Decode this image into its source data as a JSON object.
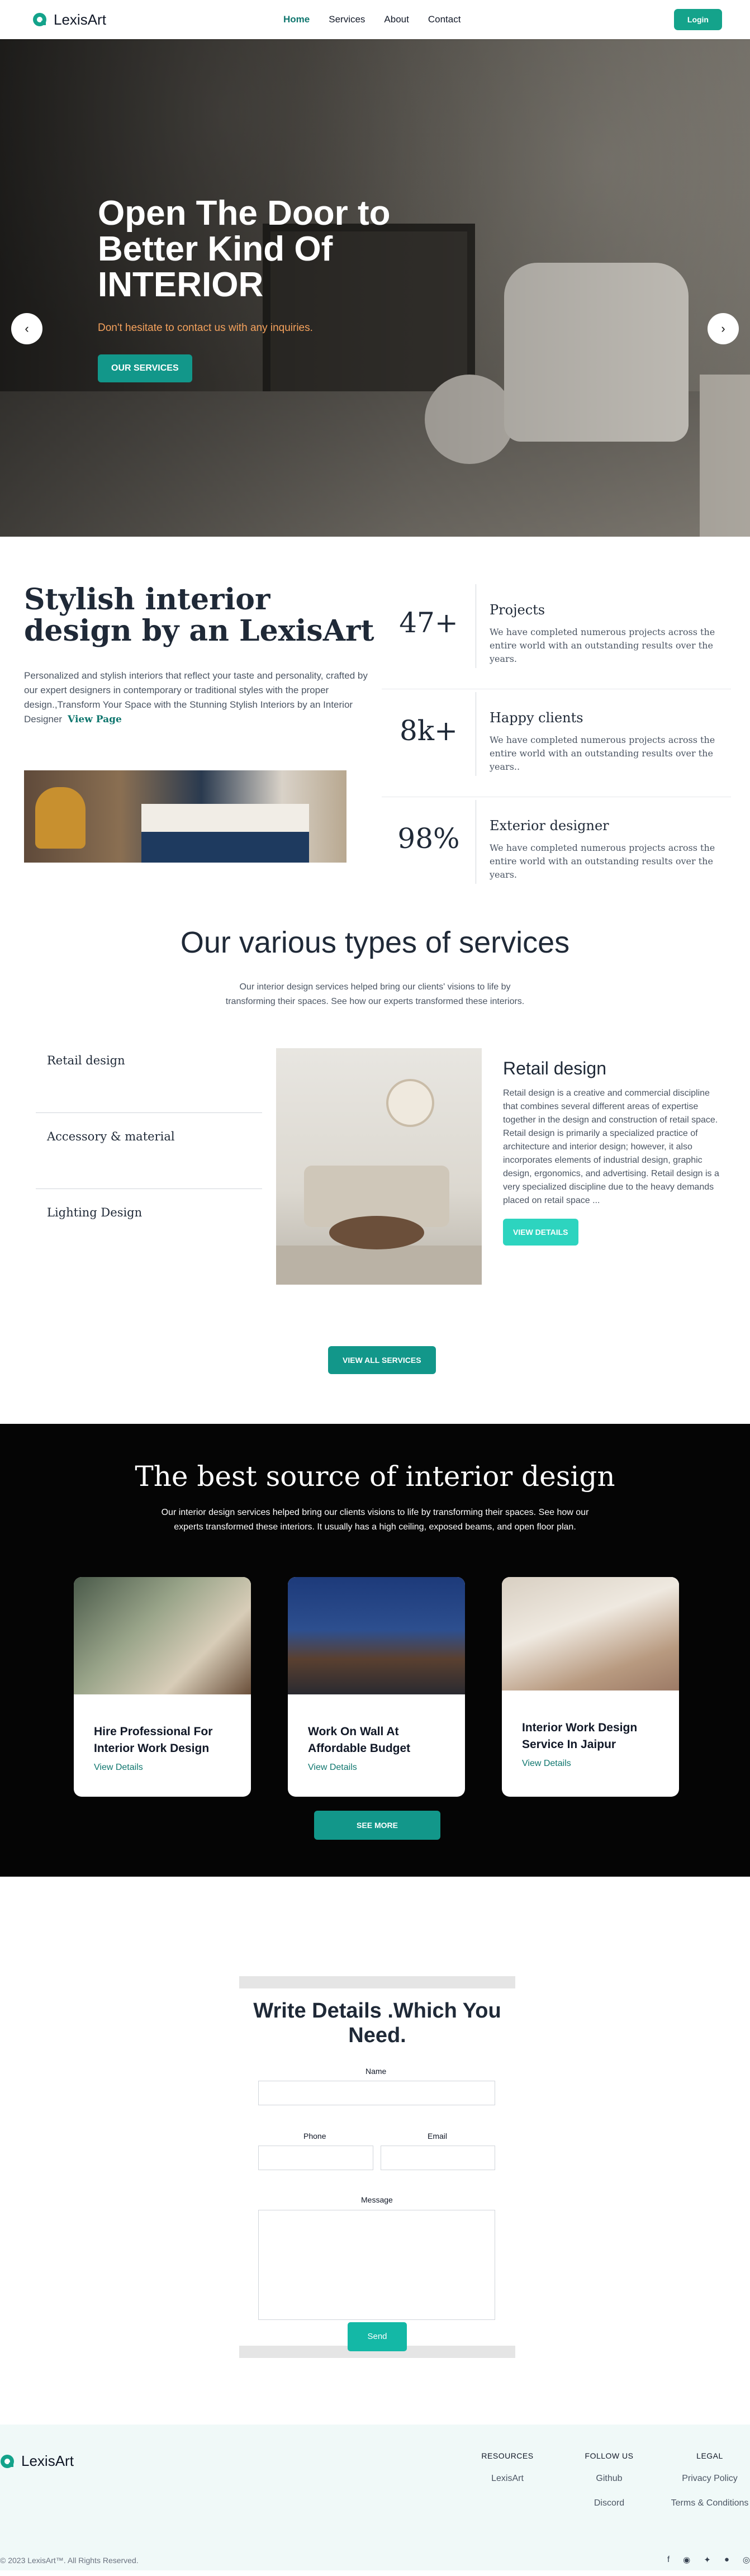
{
  "brand": {
    "name": "LexisArt",
    "accent": "#12978a"
  },
  "nav": {
    "items": [
      "Home",
      "Services",
      "About",
      "Contact"
    ],
    "login": "Login"
  },
  "hero": {
    "title_line1": "Open The Door to",
    "title_line2": "Better Kind Of",
    "title_line3": "INTERIOR",
    "subtitle": "Don't hesitate to contact us with any inquiries.",
    "button": "OUR SERVICES",
    "prev_icon": "‹",
    "next_icon": "›"
  },
  "intro": {
    "title": "Stylish interior design by an LexisArt",
    "description": "Personalized and stylish interiors that reflect your taste and personality, crafted by our expert designers in contemporary or traditional styles with the proper design.,Transform Your Space with the Stunning Stylish Interiors by an Interior Designer",
    "link": "View Page",
    "stats": [
      {
        "value": "47+",
        "title": "Projects",
        "text": "We have completed numerous projects across the entire world with an outstanding results over the years."
      },
      {
        "value": "8k+",
        "title": "Happy clients",
        "text": "We have completed numerous projects across the entire world with an outstanding results over the years.."
      },
      {
        "value": "98%",
        "title": "Exterior designer",
        "text": "We have completed numerous projects across the entire world with an outstanding results over the years."
      }
    ]
  },
  "services": {
    "title": "Our various types of services",
    "subtitle": "Our interior design services helped bring our clients' visions to life by transforming their spaces. See how our experts transformed these interiors.",
    "list": [
      "Retail design",
      "Accessory & material",
      "Lighting Design"
    ],
    "detail_title": "Retail design",
    "detail_text": "Retail design is a creative and commercial discipline that combines several different areas of expertise together in the design and construction of retail space. Retail design is primarily a specialized practice of architecture and interior design; however, it also incorporates elements of industrial design, graphic design, ergonomics, and advertising. Retail design is a very specialized discipline due to the heavy demands placed on retail space ...",
    "detail_button": "VIEW DETAILS",
    "view_all": "VIEW ALL SERVICES"
  },
  "best": {
    "title": "The best source of interior design",
    "subtitle": "Our interior design services helped bring our clients visions to life by transforming their spaces. See how our experts transformed these interiors. It usually has a high ceiling, exposed beams, and open floor plan.",
    "cards": [
      {
        "title": "Hire Professional For Interior Work Design",
        "link": "View Details"
      },
      {
        "title": "Work On Wall At Affordable Budget",
        "link": "View Details"
      },
      {
        "title": "Interior Work Design Service In Jaipur",
        "link": "View Details"
      }
    ],
    "button": "SEE MORE"
  },
  "form": {
    "title": "Write Details .Which You Need.",
    "name_label": "Name",
    "phone_label": "Phone",
    "email_label": "Email",
    "message_label": "Message",
    "send": "Send"
  },
  "footer": {
    "brand": "LexisArt",
    "columns": [
      {
        "heading": "RESOURCES",
        "links": [
          "LexisArt"
        ]
      },
      {
        "heading": "FOLLOW US",
        "links": [
          "Github",
          "Discord"
        ]
      },
      {
        "heading": "LEGAL",
        "links": [
          "Privacy Policy",
          "Terms & Conditions"
        ]
      }
    ],
    "copyright": "© 2023 LexisArt™. All Rights Reserved.",
    "social_icons": [
      "facebook-icon",
      "discord-icon",
      "twitter-icon",
      "github-icon",
      "dribbble-icon"
    ]
  }
}
